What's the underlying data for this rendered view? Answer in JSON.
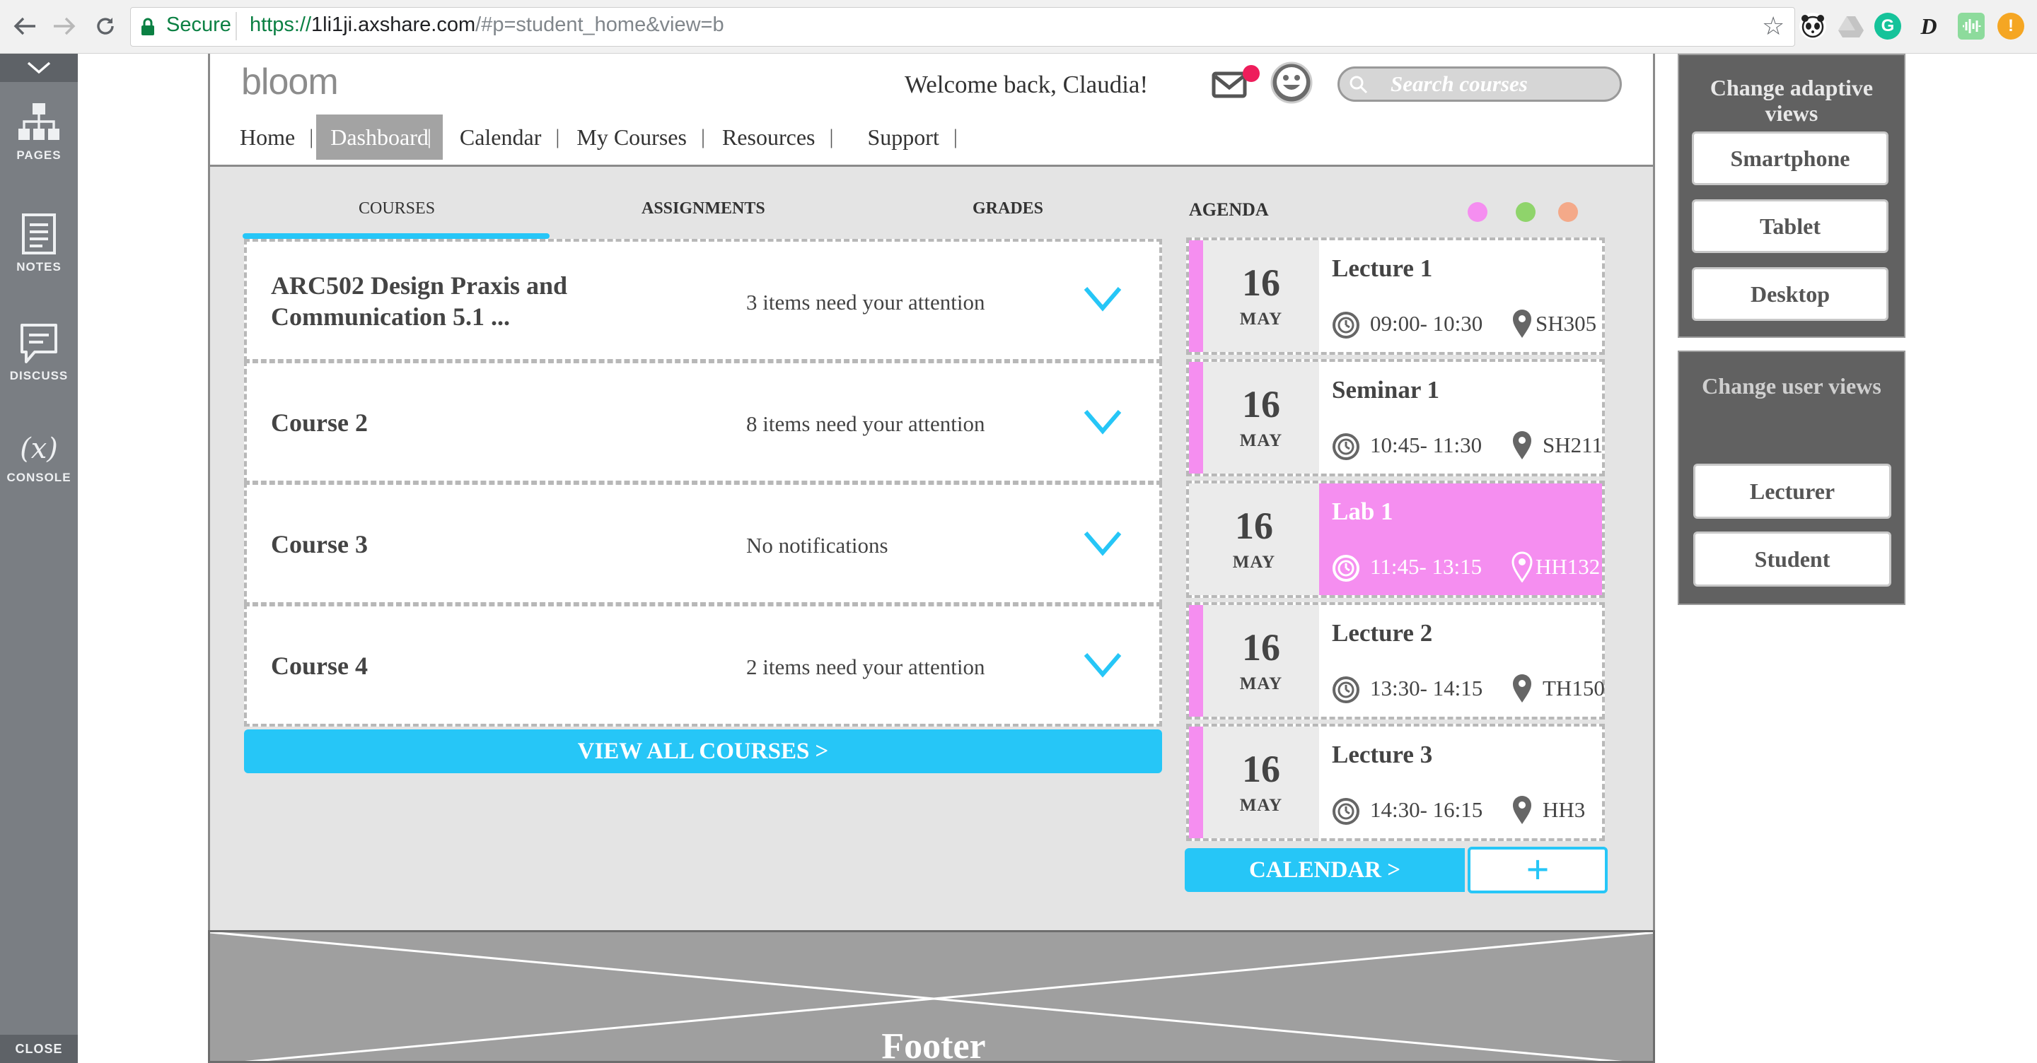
{
  "browser": {
    "secure_label": "Secure",
    "url_scheme": "https://",
    "url_host": "1li1ji.axshare.com",
    "url_rest": "/#p=student_home&view=b",
    "extensions": [
      "panda-icon",
      "drive-icon",
      "grammarly-icon",
      "d-icon",
      "waveform-icon",
      "warning-icon"
    ],
    "ext_g": "G",
    "ext_d": "D",
    "ext_warn": "!"
  },
  "sidebar": {
    "items": [
      {
        "label": "PAGES"
      },
      {
        "label": "NOTES"
      },
      {
        "label": "DISCUSS"
      },
      {
        "label": "CONSOLE",
        "glyph": "(x)"
      }
    ],
    "close_label": "CLOSE"
  },
  "header": {
    "logo": "bloom",
    "welcome": "Welcome back, Claudia!",
    "search_placeholder": "Search courses",
    "nav": [
      {
        "label": "Home"
      },
      {
        "label": "Dashboard",
        "active": true
      },
      {
        "label": "Calendar"
      },
      {
        "label": "My Courses"
      },
      {
        "label": "Resources"
      },
      {
        "label": "Support"
      }
    ],
    "nav_separator": "|"
  },
  "tabs": [
    "COURSES",
    "ASSIGNMENTS",
    "GRADES"
  ],
  "courses": [
    {
      "title": "ARC502 Design Praxis and Communication 5.1 ...",
      "status": "3 items need your attention"
    },
    {
      "title": "Course 2",
      "status": "8 items need your attention"
    },
    {
      "title": "Course 3",
      "status": "No notifications"
    },
    {
      "title": "Course 4",
      "status": "2 items need your attention"
    }
  ],
  "view_all_label": "VIEW ALL COURSES >",
  "agenda": {
    "title": "AGENDA",
    "dot_colors": [
      "#f58ef0",
      "#8fd46b",
      "#f4a989"
    ],
    "items": [
      {
        "day": "16",
        "month": "MAY",
        "title": "Lecture 1",
        "time": "09:00- 10:30",
        "room": "SH305",
        "highlight": false
      },
      {
        "day": "16",
        "month": "MAY",
        "title": "Seminar 1",
        "time": "10:45- 11:30",
        "room": "SH211",
        "highlight": false
      },
      {
        "day": "16",
        "month": "MAY",
        "title": "Lab 1",
        "time": "11:45- 13:15",
        "room": "HH132",
        "highlight": true
      },
      {
        "day": "16",
        "month": "MAY",
        "title": "Lecture 2",
        "time": "13:30- 14:15",
        "room": "TH150",
        "highlight": false
      },
      {
        "day": "16",
        "month": "MAY",
        "title": "Lecture 3",
        "time": "14:30- 16:15",
        "room": "HH3",
        "highlight": false
      }
    ],
    "calendar_label": "CALENDAR >",
    "add_label": "+"
  },
  "footer_label": "Footer",
  "adaptive_panel": {
    "title": "Change adaptive views",
    "buttons": [
      "Smartphone",
      "Tablet",
      "Desktop"
    ]
  },
  "user_panel": {
    "title": "Change user views",
    "buttons": [
      "Lecturer",
      "Student"
    ]
  },
  "colors": {
    "accent": "#26c6f7",
    "agenda_pink": "#f58ef0",
    "notification": "#ee1d5b"
  }
}
